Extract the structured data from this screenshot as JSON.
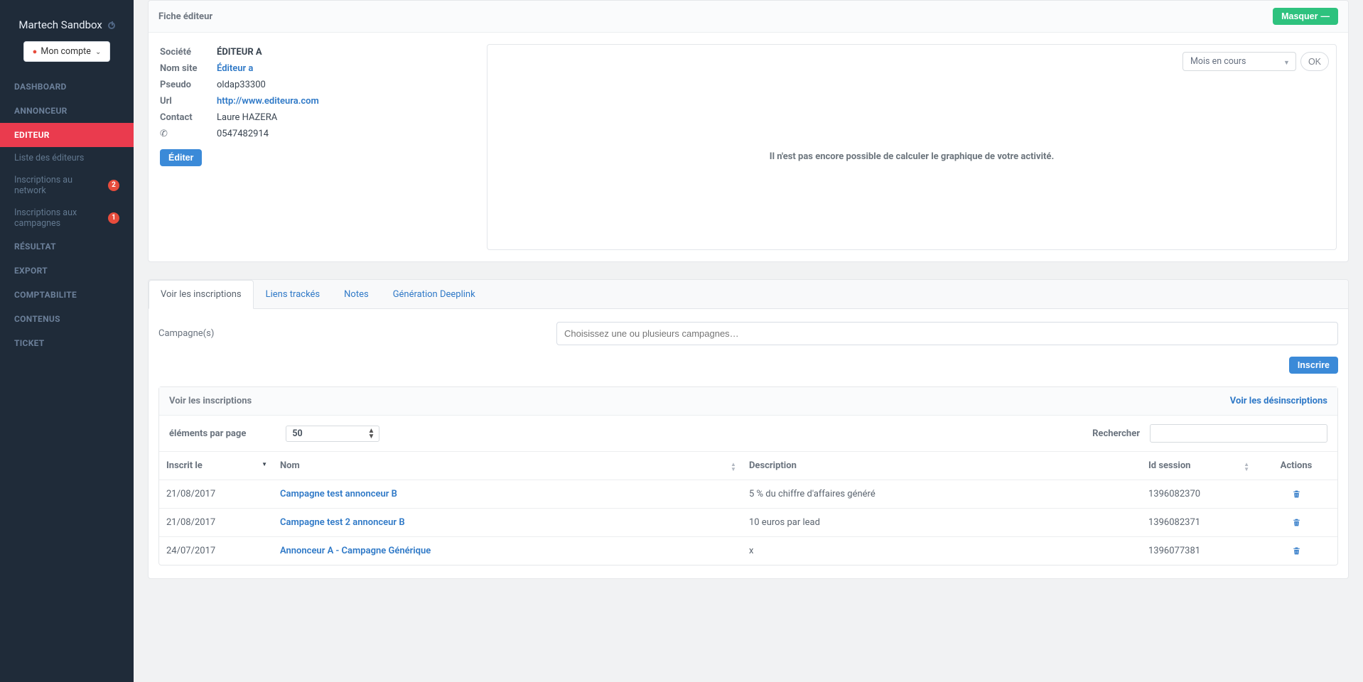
{
  "brand": "Martech Sandbox",
  "account_button": "Mon compte",
  "sidebar": {
    "items": [
      {
        "label": "DASHBOARD"
      },
      {
        "label": "ANNONCEUR"
      },
      {
        "label": "EDITEUR",
        "active": true
      },
      {
        "label": "Liste des éditeurs",
        "sub": true
      },
      {
        "label": "Inscriptions au network",
        "sub": true,
        "badge": "2"
      },
      {
        "label": "Inscriptions aux campagnes",
        "sub": true,
        "badge": "1"
      },
      {
        "label": "RÉSULTAT"
      },
      {
        "label": "EXPORT"
      },
      {
        "label": "COMPTABILITE"
      },
      {
        "label": "CONTENUS"
      },
      {
        "label": "TICKET"
      }
    ]
  },
  "fiche": {
    "panel_title": "Fiche éditeur",
    "hide_button": "Masquer",
    "labels": {
      "societe": "Société",
      "nom_site": "Nom site",
      "pseudo": "Pseudo",
      "url": "Url",
      "contact": "Contact"
    },
    "values": {
      "societe": "ÉDITEUR A",
      "nom_site": "Éditeur a",
      "pseudo": "oldap33300",
      "url": "http://www.editeura.com",
      "contact": "Laure HAZERA",
      "phone": "0547482914"
    },
    "edit_button": "Éditer",
    "select_month": "Mois en cours",
    "ok_button": "OK",
    "empty_chart": "Il n'est pas encore possible de calculer le graphique de votre activité."
  },
  "tabs": [
    "Voir les inscriptions",
    "Liens trackés",
    "Notes",
    "Génération Deeplink"
  ],
  "campagnes": {
    "label": "Campagne(s)",
    "placeholder": "Choisissez une ou plusieurs campagnes…",
    "inscrire": "Inscrire"
  },
  "inscriptions": {
    "title": "Voir les inscriptions",
    "desinscriptions_link": "Voir les désinscriptions",
    "per_page_label": "éléments par page",
    "per_page_value": "50",
    "search_label": "Rechercher",
    "columns": {
      "inscrit_le": "Inscrit le",
      "nom": "Nom",
      "description": "Description",
      "id_session": "Id session",
      "actions": "Actions"
    },
    "rows": [
      {
        "date": "21/08/2017",
        "nom": "Campagne test annonceur B",
        "desc": "5 % du chiffre d'affaires généré",
        "id": "1396082370"
      },
      {
        "date": "21/08/2017",
        "nom": "Campagne test 2 annonceur B",
        "desc": "10 euros par lead",
        "id": "1396082371"
      },
      {
        "date": "24/07/2017",
        "nom": "Annonceur A - Campagne Générique",
        "desc": "x",
        "id": "1396077381"
      }
    ]
  }
}
